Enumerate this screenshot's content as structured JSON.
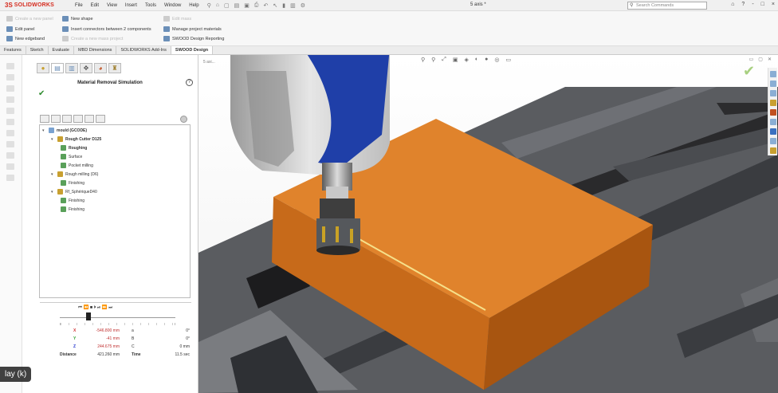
{
  "titlebar": {
    "logo_mark": "3S",
    "logo_text": "SOLIDWORKS",
    "menu": [
      "File",
      "Edit",
      "View",
      "Insert",
      "Tools",
      "Window",
      "Help"
    ],
    "doc_title": "5 axis *",
    "search_placeholder": "Search Commands",
    "window_controls": [
      "⌂",
      "?",
      "-",
      "□",
      "×"
    ]
  },
  "ribbon": {
    "create_new_panel": "Create a new panel",
    "new_shape": "New shape",
    "edit_panel": "Edit panel",
    "insert_connectors": "Insert connectors between 2 components",
    "manage_materials": "Manage project materials",
    "new_edgeband": "New edgeband",
    "create_new_project": "Create a new mass project",
    "design_reporting": "SWOOD Design Reporting",
    "edit_mass": "Edit mass"
  },
  "command_tabs": [
    "Features",
    "Sketch",
    "Evaluate",
    "MBD Dimensions",
    "SOLIDWORKS Add-Ins",
    "SWOOD Design"
  ],
  "property_manager": {
    "title": "Material Removal Simulation",
    "help": "?",
    "ok": "✔"
  },
  "tree": {
    "root": "mould (GCODE)",
    "cutter1": "Rough Cutter D125",
    "op_roughing": "Roughing",
    "op_surface": "Surface",
    "op_pocket": "Pocket milling",
    "cutter2": "Rough milling (D6)",
    "op_finishing1": "Finishing",
    "cutter3": "Rf_SphériqueD40",
    "op_finishing2": "Finishing",
    "op_finishing3": "Finishing"
  },
  "playback": {
    "controls": "⏮  ⏪  ■  ⏵  ⏯  ⏩  ⏭",
    "x_label": "X",
    "x_value": "-546.800 mm",
    "y_label": "Y",
    "y_value": "-41 mm",
    "z_label": "Z",
    "z_value": "244.675 mm",
    "distance_label": "Distance",
    "distance_value": "421.260 mm",
    "a_label": "a",
    "a_value": "0°",
    "b_label": "B",
    "b_value": "0°",
    "c_label": "C",
    "c_value": "0 mm",
    "time_label": "Time",
    "time_value": "11.5 sec"
  },
  "viewport": {
    "crumb": "5 axi...",
    "toolbar_icons": [
      "⚲",
      "⚲",
      "⤢",
      "▣",
      "◈",
      "◐",
      "●",
      "◎",
      "▭"
    ]
  },
  "overlay": {
    "play_label": "lay (k)"
  },
  "colors": {
    "accent_red": "#d52b1e",
    "block_orange": "#d4741c"
  }
}
